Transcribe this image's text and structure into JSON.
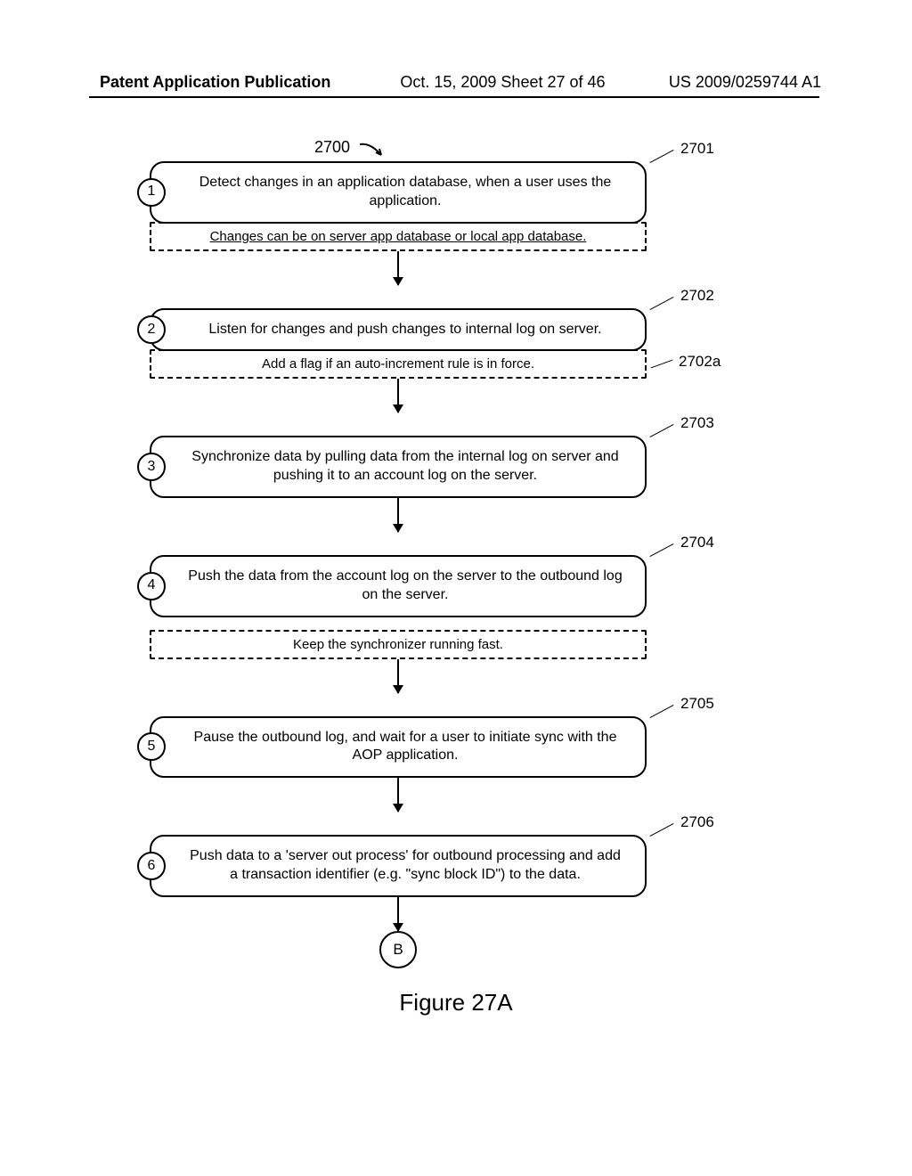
{
  "header": {
    "left": "Patent Application Publication",
    "center": "Oct. 15, 2009  Sheet 27 of 46",
    "right": "US 2009/0259744 A1"
  },
  "diagram": {
    "figure_ref": "2700",
    "steps": [
      {
        "num": "1",
        "ref": "2701",
        "text": "Detect changes in an application database, when a user uses the application.",
        "sub": "Changes can be on server app database or local app database.",
        "sub_underlined": true,
        "sub_attached": true
      },
      {
        "num": "2",
        "ref": "2702",
        "text": "Listen for changes and push changes to internal log on server.",
        "sub": "Add a flag if an auto-increment rule is in force.",
        "sub_ref": "2702a",
        "sub_attached": true
      },
      {
        "num": "3",
        "ref": "2703",
        "text": "Synchronize data by pulling data from the internal log on server and pushing it to an account log on the server."
      },
      {
        "num": "4",
        "ref": "2704",
        "text": "Push the data from the account log on the server to the outbound log on the server.",
        "sub": "Keep the synchronizer running fast.",
        "sub_attached": false
      },
      {
        "num": "5",
        "ref": "2705",
        "text": "Pause the outbound log, and wait for a user to initiate sync with the AOP application."
      },
      {
        "num": "6",
        "ref": "2706",
        "text": "Push data to a 'server out process' for outbound processing and add a transaction identifier (e.g. \"sync block ID\") to the data."
      }
    ],
    "connector": "B"
  },
  "caption": "Figure 27A"
}
